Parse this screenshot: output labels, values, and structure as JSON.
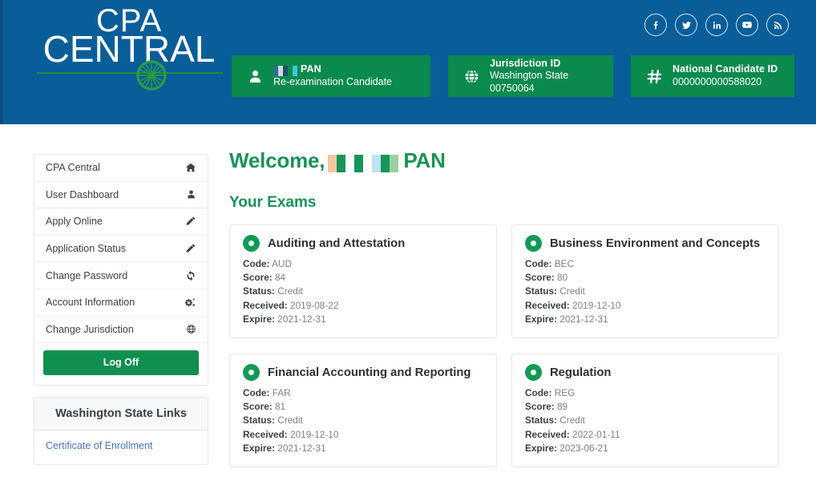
{
  "header": {
    "logo": {
      "line1": "CPA",
      "line2": "CENTRAL",
      "icon": "compass-rose-icon"
    },
    "social": [
      {
        "name": "facebook-icon",
        "label": "f"
      },
      {
        "name": "twitter-icon",
        "label": "t"
      },
      {
        "name": "linkedin-icon",
        "label": "in"
      },
      {
        "name": "youtube-icon",
        "label": "yt"
      },
      {
        "name": "rss-icon",
        "label": "rss"
      }
    ],
    "cards": [
      {
        "icon": "person-icon",
        "title": "PAN",
        "subtitle": "Re-examination Candidate",
        "redacted": true
      },
      {
        "icon": "globe-icon",
        "title": "Jurisdiction ID",
        "subtitle": "Washington State 00750064",
        "redacted": false
      },
      {
        "icon": "hash-icon",
        "title": "National Candidate ID",
        "subtitle": "0000000000588020",
        "redacted": false
      }
    ]
  },
  "sidebar": {
    "items": [
      {
        "label": "CPA Central",
        "icon": "home-icon"
      },
      {
        "label": "User Dashboard",
        "icon": "user-icon"
      },
      {
        "label": "Apply Online",
        "icon": "pencil-icon"
      },
      {
        "label": "Application Status",
        "icon": "pencil-icon"
      },
      {
        "label": "Change Password",
        "icon": "refresh-icon"
      },
      {
        "label": "Account Information",
        "icon": "gears-icon"
      },
      {
        "label": "Change Jurisdiction",
        "icon": "globe-icon"
      }
    ],
    "logoff_label": "Log Off",
    "links_title": "Washington State Links",
    "links": [
      {
        "label": "Certificate of Enrollment"
      }
    ]
  },
  "main": {
    "welcome_prefix": "Welcome,",
    "welcome_name": "PAN",
    "section_title": "Your Exams",
    "labels": {
      "code": "Code:",
      "score": "Score:",
      "status": "Status:",
      "received": "Received:",
      "expire": "Expire:"
    },
    "exams": [
      {
        "name": "Auditing and Attestation",
        "code": "AUD",
        "score": "84",
        "status": "Credit",
        "received": "2019-08-22",
        "expire": "2021-12-31"
      },
      {
        "name": "Business Environment and Concepts",
        "code": "BEC",
        "score": "80",
        "status": "Credit",
        "received": "2019-12-10",
        "expire": "2021-12-31"
      },
      {
        "name": "Financial Accounting and Reporting",
        "code": "FAR",
        "score": "81",
        "status": "Credit",
        "received": "2019-12-10",
        "expire": "2021-12-31"
      },
      {
        "name": "Regulation",
        "code": "REG",
        "score": "89",
        "status": "Credit",
        "received": "2022-01-11",
        "expire": "2023-06-21"
      }
    ]
  },
  "colors": {
    "header_blue": "#095e99",
    "brand_green": "#0a8a4d",
    "heading_green": "#1a9257",
    "link_blue": "#4a73b5"
  }
}
